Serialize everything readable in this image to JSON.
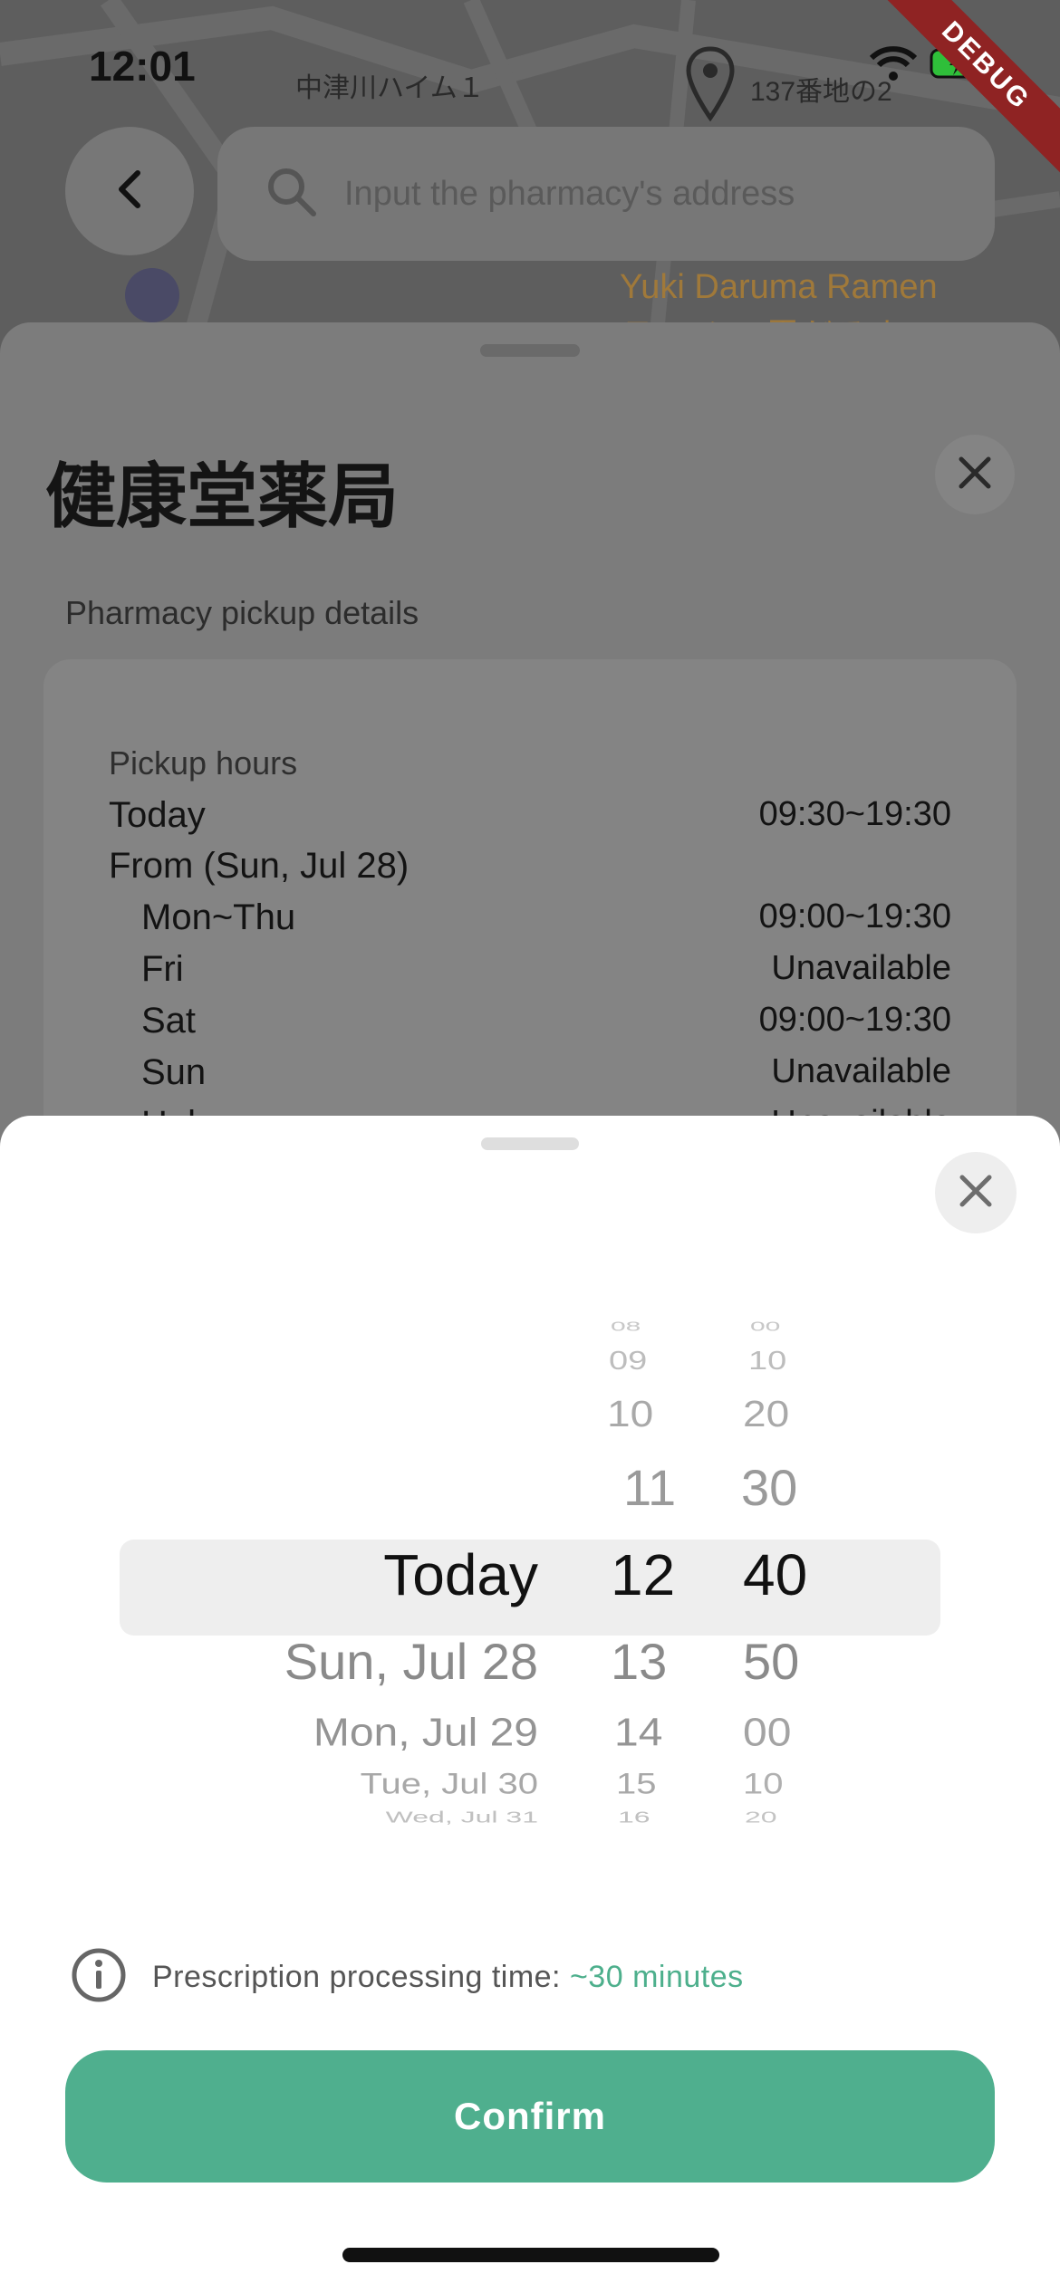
{
  "status_bar": {
    "time": "12:01"
  },
  "debug_ribbon": "DEBUG",
  "map": {
    "labels": [
      "中津川ハイム１",
      "137番地の2",
      "Yuki Daruma Ramen",
      "ラーメン 雪だるま"
    ]
  },
  "search": {
    "placeholder": "Input the pharmacy's address"
  },
  "pharmacy": {
    "name": "健康堂薬局",
    "section_label": "Pharmacy pickup details",
    "hours_label": "Pickup hours",
    "rows": [
      {
        "label": "Today",
        "value": "09:30~19:30"
      },
      {
        "label": "From (Sun, Jul 28)",
        "value": ""
      },
      {
        "label": "Mon~Thu",
        "value": "09:00~19:30"
      },
      {
        "label": "Fri",
        "value": "Unavailable"
      },
      {
        "label": "Sat",
        "value": "09:00~19:30"
      },
      {
        "label": "Sun",
        "value": "Unavailable"
      },
      {
        "label": "Hol",
        "value": "Unavailable"
      }
    ]
  },
  "picker": {
    "dates": [
      "Today",
      "Sun, Jul 28",
      "Mon, Jul 29",
      "Tue, Jul 30",
      "Wed, Jul 31"
    ],
    "hours": [
      "08",
      "09",
      "10",
      "11",
      "12",
      "13",
      "14",
      "15",
      "16"
    ],
    "minutes": [
      "00",
      "10",
      "20",
      "30",
      "40",
      "50",
      "00",
      "10",
      "20"
    ],
    "selected": {
      "date": "Today",
      "hour": "12",
      "minute": "40"
    },
    "info_prefix": "Prescription processing time: ",
    "info_value": "~30 minutes",
    "confirm_label": "Confirm"
  },
  "colors": {
    "accent": "#4FAF8E",
    "debug": "#8F2323"
  }
}
